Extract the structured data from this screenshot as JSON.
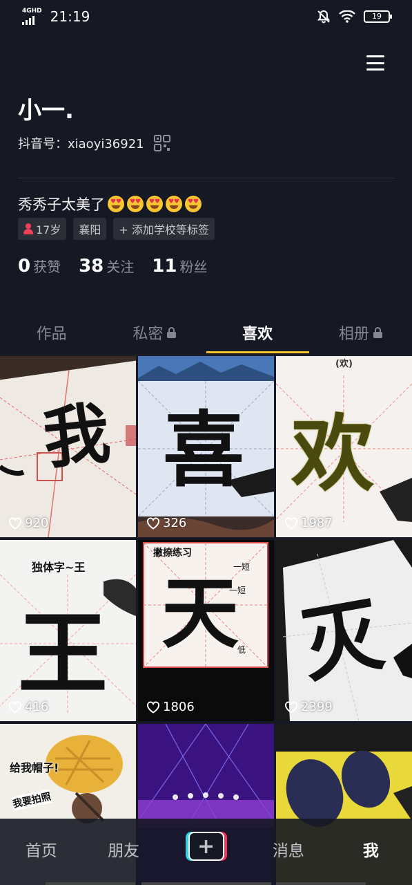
{
  "status_bar": {
    "network": "4GHD",
    "time": "21:19",
    "battery": "19",
    "icons": [
      "signal-icon",
      "bell-off-icon",
      "wifi-icon",
      "battery-icon"
    ]
  },
  "profile": {
    "name": "小一.",
    "id_label": "抖音号：xiaoyi36921",
    "bio": "秀秀子太美了",
    "bio_emoji_count": 5,
    "tags": {
      "age": "17岁",
      "city": "襄阳",
      "add_school": "+ 添加学校等标签"
    },
    "stats": {
      "likes_num": "0",
      "likes_label": "获赞",
      "following_num": "38",
      "following_label": "关注",
      "followers_num": "11",
      "followers_label": "粉丝"
    }
  },
  "tabs": {
    "works": "作品",
    "private": "私密",
    "liked": "喜欢",
    "album": "相册",
    "active": "liked"
  },
  "videos": [
    {
      "likes": "920",
      "glyph": "我"
    },
    {
      "likes": "326",
      "glyph": "喜"
    },
    {
      "likes": "1987",
      "glyph": "欢",
      "caption": "(欢)"
    },
    {
      "likes": "416",
      "glyph": "王",
      "caption": "独体字~王"
    },
    {
      "likes": "1806",
      "glyph": "天",
      "caption": "撇捺练习",
      "notes": [
        "一短",
        "一短",
        "低"
      ]
    },
    {
      "likes": "2399",
      "glyph": "灭"
    },
    {
      "caption": "给我帽子!",
      "caption2": "我要拍照"
    },
    {},
    {}
  ],
  "bottom_nav": {
    "home": "首页",
    "friends": "朋友",
    "plus": "+",
    "messages": "消息",
    "me": "我",
    "active": "me"
  },
  "colors": {
    "background": "#161823",
    "accent": "#f5c431",
    "tiktok_cyan": "#2ad6e0",
    "tiktok_red": "#f4345d",
    "age_icon": "#f0415a"
  }
}
